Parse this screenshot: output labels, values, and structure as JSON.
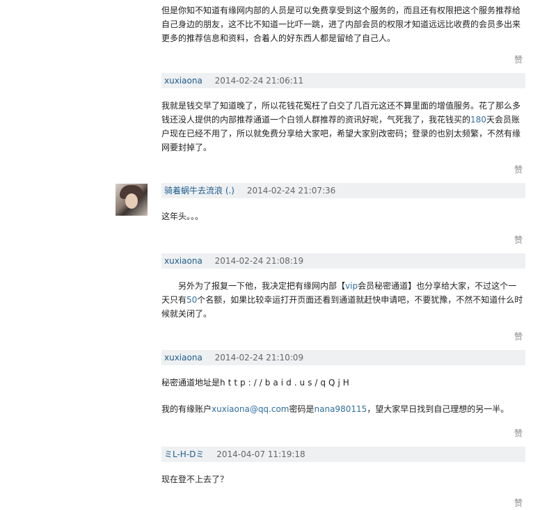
{
  "comments": [
    {
      "text": "但是你知不知道有缘网内部的人员是可以免费享受到这个服务的，而且还有权限把这个服务推荐给自己身边的朋友，这不比不知道一比吓一跳，进了内部会员的权限才知道远远比收费的会员多出来更多的推荐信息和资料，合着人的好东西人都是留给了自己人。"
    }
  ],
  "like_label": "赞",
  "entries": [
    {
      "user": "xuxiaona",
      "time": "2014-02-24 21:06:11",
      "text_a": "我就是钱交早了知道晚了，所以花钱花冤枉了白交了几百元这还不算里面的增值服务。花了那么多钱还没人提供的内部推荐通道一个白领人群推荐的资讯好呢，气死我了，我花钱买的",
      "text_hl": "180",
      "text_b": "天会员账户现在已经不用了，所以就免费分享给大家吧，希望大家别改密码；登录的也别太频繁，不然有缘网要封掉了。"
    },
    {
      "user": "骑着蜗牛去流浪 (.)",
      "time": "2014-02-24 21:07:36",
      "text": "这年头。。。"
    },
    {
      "user": "xuxiaona",
      "time": "2014-02-24 21:08:19",
      "text_a": "另外为了报复一下他，我决定把有缘网内部【",
      "text_hl1": "vip",
      "text_b": "会员秘密通道】也分享给大家，不过这个一天只有",
      "text_hl2": "50",
      "text_c": "个名额，如果比较幸运打开页面还看到通道就赶快申请吧，不要犹豫，不然不知道什么时候就关闭了。"
    },
    {
      "user": "xuxiaona",
      "time": "2014-02-24 21:10:09",
      "line1_a": "秘密通道地址是",
      "line1_url": "http://baid.us/qQjH",
      "line2_a": "我的有缘账户",
      "line2_acct": "xuxiaona@qq.com",
      "line2_b": "密码是",
      "line2_pw": "nana980115",
      "line2_c": "，望大家早日找到自己理想的另一半。"
    },
    {
      "user": "ミL-H-Dミ",
      "time": "2014-04-07 11:19:18",
      "text": "现在登不上去了？"
    }
  ]
}
